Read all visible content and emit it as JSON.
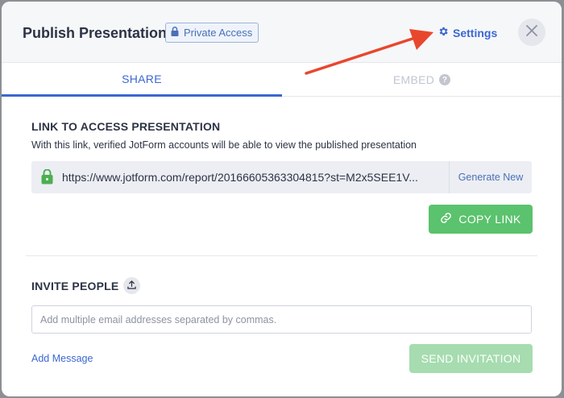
{
  "header": {
    "title": "Publish Presentation",
    "badge": "Private Access",
    "settings_label": "Settings"
  },
  "tabs": [
    {
      "label": "SHARE",
      "active": true
    },
    {
      "label": "EMBED",
      "active": false
    }
  ],
  "link_section": {
    "title": "LINK TO ACCESS PRESENTATION",
    "description": "With this link, verified JotForm accounts will be able to view the published presentation",
    "url": "https://www.jotform.com/report/2016660536330481​5?st=M2x5SEE1V...",
    "generate_new": "Generate New",
    "copy_link": "COPY LINK"
  },
  "invite_section": {
    "title": "INVITE PEOPLE",
    "email_placeholder": "Add multiple email addresses separated by commas.",
    "add_message": "Add Message",
    "send_label": "SEND INVITATION"
  },
  "colors": {
    "accent": "#3b67d3",
    "success": "#5bc26d",
    "success_disabled": "#a6dcaf",
    "annotation_arrow": "#e8472e"
  },
  "icons": {
    "badge": "lock-icon",
    "settings": "gear-icon",
    "close": "close-icon",
    "embed_help": "question-icon",
    "url_lock": "lock-icon",
    "copy": "link-icon",
    "invite_upload": "upload-icon"
  }
}
